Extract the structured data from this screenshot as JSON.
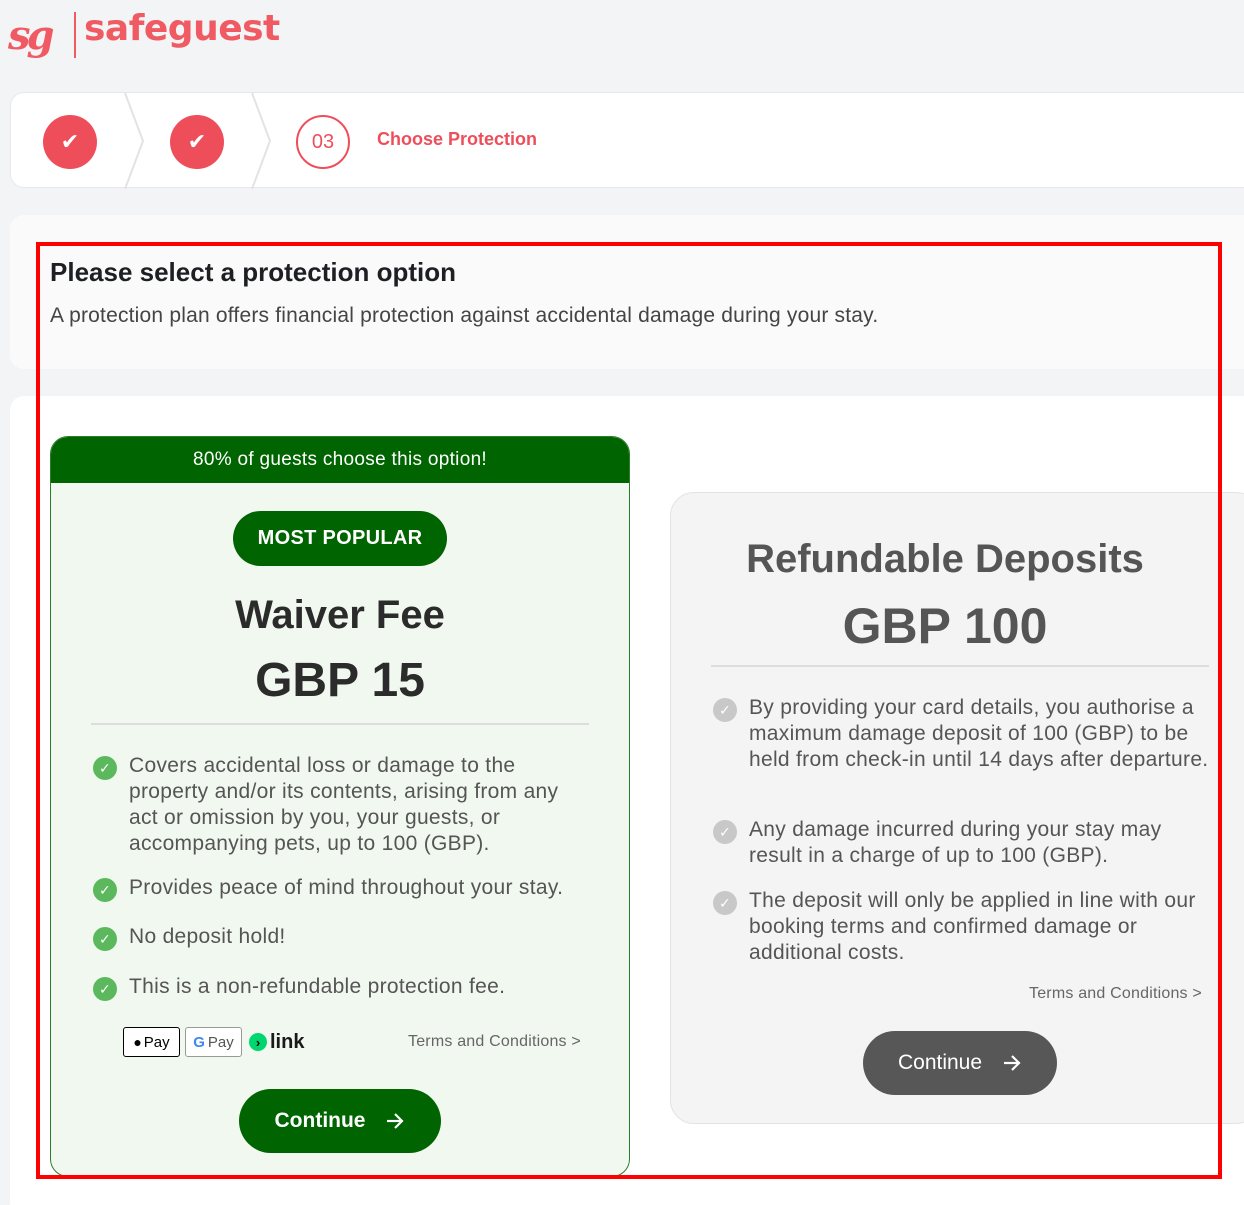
{
  "brand": {
    "mark": "sg",
    "name": "safeguest",
    "color": "#f05a63"
  },
  "stepper": {
    "step1_icon": "check-icon",
    "step2_icon": "check-icon",
    "step3_number": "03",
    "step3_label": "Choose Protection"
  },
  "intro": {
    "title": "Please select a protection option",
    "description": "A protection plan offers financial protection against accidental damage during your stay."
  },
  "waiver_card": {
    "banner": "80% of guests choose this option!",
    "badge": "MOST POPULAR",
    "title": "Waiver Fee",
    "price": "GBP 15",
    "features": [
      "Covers accidental loss or damage to the property and/or its contents, arising from any act or omission by you, your guests, or accompanying pets, up to 100 (GBP).",
      "Provides peace of mind throughout your stay.",
      "No deposit hold!",
      "This is a non-refundable protection fee."
    ],
    "payment_methods": {
      "apple": "Pay",
      "google": "Pay",
      "link": "link"
    },
    "terms": "Terms and Conditions >",
    "button": "Continue",
    "accent": "#006400"
  },
  "deposit_card": {
    "title": "Refundable Deposits",
    "price": "GBP 100",
    "features": [
      "By providing your card details, you authorise a maximum damage deposit of 100 (GBP) to be held from check-in until 14 days after departure.",
      "Any damage incurred during your stay may result in a charge of up to 100 (GBP).",
      "The deposit will only be applied in line with our booking terms and confirmed damage or additional costs."
    ],
    "terms": "Terms and Conditions >",
    "button": "Continue",
    "accent": "#575757"
  }
}
